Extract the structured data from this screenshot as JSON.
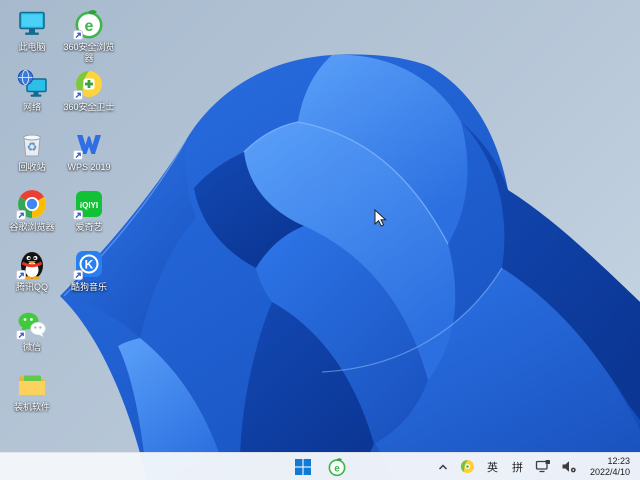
{
  "colors": {
    "desktop_bg_top": "#a7bacd",
    "desktop_bg_bottom": "#c9d7e5",
    "bloom_dark": "#0c3a97",
    "bloom_mid": "#1d5ed2",
    "bloom_bright": "#2e76e9",
    "bloom_light": "#5aa0f9",
    "taskbar_bg": "#f2f5f9",
    "start_blue": "#0f7bd7",
    "icon_label_text": "#ffffff"
  },
  "desktop": {
    "icons": [
      {
        "label": "此电脑",
        "name": "this-pc",
        "shortcut": false
      },
      {
        "label": "360安全浏览器",
        "name": "360-secure-browser",
        "shortcut": true
      },
      {
        "label": "网络",
        "name": "network",
        "shortcut": false
      },
      {
        "label": "360安全卫士",
        "name": "360-security-guard",
        "shortcut": true
      },
      {
        "label": "回收站",
        "name": "recycle-bin",
        "shortcut": false
      },
      {
        "label": "WPS 2019",
        "name": "wps-2019",
        "shortcut": true
      },
      {
        "label": "谷歌浏览器",
        "name": "google-chrome",
        "shortcut": true
      },
      {
        "label": "爱奇艺",
        "name": "iqiyi",
        "shortcut": true
      },
      {
        "label": "腾讯QQ",
        "name": "tencent-qq",
        "shortcut": true
      },
      {
        "label": "酷狗音乐",
        "name": "kugou-music",
        "shortcut": true
      },
      {
        "label": "微信",
        "name": "wechat",
        "shortcut": true
      },
      {
        "label": "装机软件",
        "name": "software-folder",
        "shortcut": false
      }
    ]
  },
  "taskbar": {
    "center_buttons": [
      "start",
      "360-secure-browser"
    ],
    "tray": {
      "ime_english": "英",
      "ime_pinyin": "拼",
      "time": "12:23",
      "date": "2022/4/10"
    }
  }
}
